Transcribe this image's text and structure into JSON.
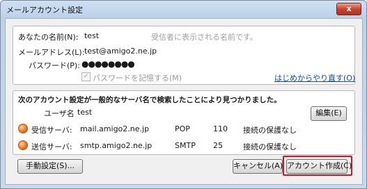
{
  "window": {
    "title": "メールアカウント設定",
    "close_label": "x"
  },
  "form": {
    "name_label": "あなたの名前(N):",
    "name_value": "test",
    "name_hint": "受信者に表示される名前です。",
    "email_label": "メールアドレス(L):",
    "email_value": "test@amigo2.ne.jp",
    "password_label": "パスワード(P):",
    "password_value": "●●●●●●●●",
    "remember_label": "パスワードを記憶する(M)",
    "remember_checked": true,
    "restart_link": "はじめからやり直す(O)"
  },
  "result": {
    "heading": "次のアカウント設定が一般的なサーバ名で検索したことにより見つかりました。",
    "username_label": "ユーザ名",
    "username_value": "test",
    "edit_button": "編集(E)",
    "incoming": {
      "label": "受信サーバ:",
      "host": "mail.amigo2.ne.jp",
      "protocol": "POP",
      "port": "110",
      "security": "接続の保護なし"
    },
    "outgoing": {
      "label": "送信サーバ:",
      "host": "smtp.amigo2.ne.jp",
      "protocol": "SMTP",
      "port": "25",
      "security": "接続の保護なし"
    }
  },
  "buttons": {
    "manual": "手動設定(S)...",
    "cancel": "キャンセル(A)",
    "create": "アカウント作成(C)"
  },
  "colors": {
    "highlight": "#e0101a",
    "status_dot": "#f07a1e",
    "link": "#0a4bc4"
  }
}
